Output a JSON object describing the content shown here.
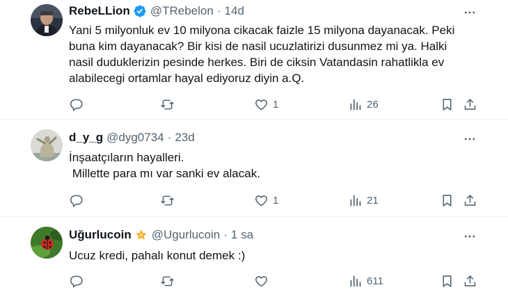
{
  "tweets": [
    {
      "name": "RebeLLion",
      "verified": true,
      "handle": "@TRebelon",
      "separator": "·",
      "time": "14d",
      "lines": [
        "Yani 5 milyonluk ev 10 milyona cikacak faizle 15 milyona dayanacak. Peki",
        "buna kim dayanacak? Bir kisi de nasil ucuzlatirizi dusunmez mi ya. Halki",
        "nasil duduklerizin pesinde herkes. Biri de ciksin Vatandasin rahatlikla ev",
        "alabilecegi ortamlar hayal ediyoruz diyin a.Q."
      ],
      "replies": "",
      "retweets": "",
      "likes": "1",
      "views": "26",
      "avatar_icon": "man-portrait-avatar"
    },
    {
      "name": "d_y_g",
      "handle": "@dyg0734",
      "separator": "·",
      "time": "23d",
      "lines": [
        "İnşaatçıların hayalleri.",
        " Millette para mı var sanki ev alacak."
      ],
      "replies": "",
      "retweets": "",
      "likes": "1",
      "views": "21",
      "avatar_icon": "sculpture-avatar"
    },
    {
      "name": "Uğurlucoin",
      "emoji": "🌟",
      "handle": "@Ugurlucoin",
      "separator": "·",
      "time": "1 sa",
      "lines": [
        "Ucuz kredi, pahalı konut demek :)"
      ],
      "replies": "",
      "retweets": "",
      "likes": "",
      "views": "611",
      "avatar_icon": "ladybug-avatar"
    }
  ],
  "colors": {
    "text": "#0f1419",
    "secondary": "#536471",
    "verified": "#1d9bf0",
    "divider": "#eff3f4",
    "star": "#f5a623"
  }
}
